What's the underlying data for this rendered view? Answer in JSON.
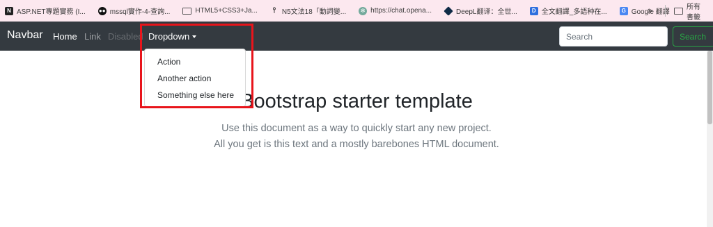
{
  "bookmarks": {
    "items": [
      {
        "label": "ASP.NET專題實務 (I...",
        "icon": "notion-icon"
      },
      {
        "label": "mssql實作-4-查詢...",
        "icon": "medium-icon"
      },
      {
        "label": "HTML5+CSS3+Ja...",
        "icon": "folder-icon"
      },
      {
        "label": "N5文法18「動詞變...",
        "icon": "pin-icon"
      },
      {
        "label": "https://chat.opena...",
        "icon": "chatgpt-icon"
      },
      {
        "label": "DeepL翻译：全世...",
        "icon": "deepl-icon"
      },
      {
        "label": "全文翻譯_多語种在...",
        "icon": "d-icon"
      },
      {
        "label": "Google 翻譯",
        "icon": "google-translate-icon"
      }
    ],
    "more": "»",
    "all_bookmarks": "所有書籤"
  },
  "navbar": {
    "brand": "Navbar",
    "links": {
      "home": "Home",
      "link": "Link",
      "disabled": "Disabled",
      "dropdown": "Dropdown"
    },
    "search": {
      "placeholder": "Search",
      "button": "Search"
    },
    "colors": {
      "background": "#343a40",
      "success": "#28a745"
    }
  },
  "dropdown": {
    "items": [
      "Action",
      "Another action",
      "Something else here"
    ]
  },
  "main": {
    "heading": "Bootstrap starter template",
    "lead_line1": "Use this document as a way to quickly start any new project.",
    "lead_line2": "All you get is this text and a mostly barebones HTML document."
  },
  "annotation": {
    "color": "#e8141b"
  }
}
